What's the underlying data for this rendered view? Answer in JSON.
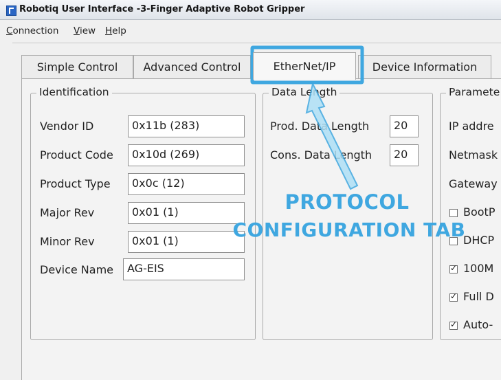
{
  "window": {
    "title": "Robotiq User Interface -3-Finger Adaptive Robot Gripper"
  },
  "menu": [
    "Connection",
    "View",
    "Help"
  ],
  "tabs": [
    {
      "label": "Simple Control"
    },
    {
      "label": "Advanced Control"
    },
    {
      "label": "EtherNet/IP"
    },
    {
      "label": "Device Information"
    }
  ],
  "identification": {
    "legend": "Identification",
    "fields": [
      {
        "label": "Vendor ID",
        "value": "0x11b (283)"
      },
      {
        "label": "Product Code",
        "value": "0x10d (269)"
      },
      {
        "label": "Product Type",
        "value": "0x0c (12)"
      },
      {
        "label": "Major Rev",
        "value": "0x01 (1)"
      },
      {
        "label": "Minor Rev",
        "value": "0x01 (1)"
      },
      {
        "label": "Device Name",
        "value": "AG-EIS"
      }
    ]
  },
  "data_length": {
    "legend": "Data Length",
    "fields": [
      {
        "label": "Prod. Data Length",
        "value": "20"
      },
      {
        "label": "Cons. Data Length",
        "value": "20"
      }
    ]
  },
  "parameters": {
    "legend": "Paramete",
    "labels": [
      "IP addre",
      "Netmask",
      "Gateway"
    ],
    "checkboxes": [
      {
        "label": "BootP",
        "checked": false
      },
      {
        "label": "DHCP",
        "checked": false
      },
      {
        "label": "100M",
        "checked": true
      },
      {
        "label": "Full D",
        "checked": true
      },
      {
        "label": "Auto-",
        "checked": true
      }
    ]
  },
  "annotation": {
    "line1": "PROTOCOL",
    "line2": "CONFIGURATION TAB",
    "color": "#3fa7e0"
  }
}
